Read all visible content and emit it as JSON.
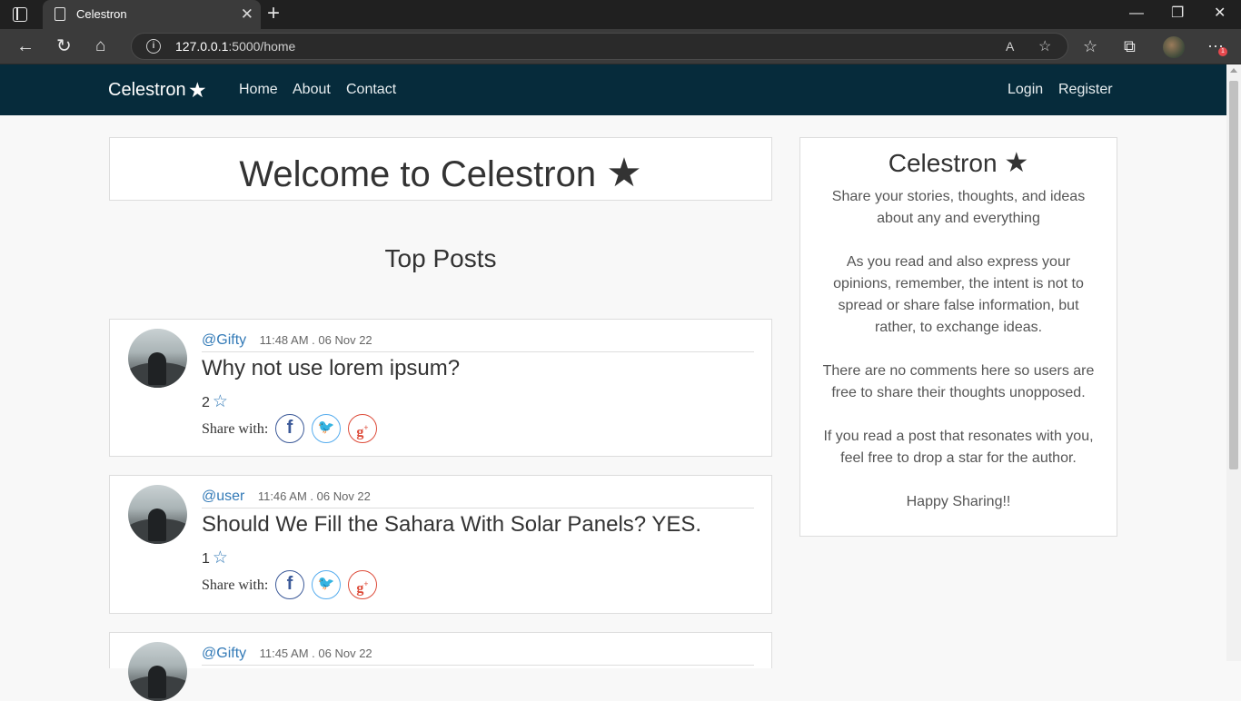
{
  "browser": {
    "tab_title": "Celestron",
    "tab_close": "✕",
    "new_tab": "+",
    "url_host": "127.0.0.1",
    "url_path": ":5000/home",
    "window_controls": {
      "minimize": "—",
      "maximize": "❐",
      "close": "✕"
    }
  },
  "site": {
    "brand": "Celestron",
    "nav": {
      "home": "Home",
      "about": "About",
      "contact": "Contact",
      "login": "Login",
      "register": "Register"
    },
    "colors": {
      "navbar": "#062b3b",
      "link": "#337ab7"
    }
  },
  "main": {
    "welcome": "Welcome to Celestron",
    "top_posts_heading": "Top Posts",
    "share_label": "Share with:",
    "posts": [
      {
        "user": "@Gifty",
        "time": "11:48 AM . 06 Nov 22",
        "title": "Why not use lorem ipsum?",
        "stars": "2"
      },
      {
        "user": "@user",
        "time": "11:46 AM . 06 Nov 22",
        "title": "Should We Fill the Sahara With Solar Panels? YES.",
        "stars": "1"
      },
      {
        "user": "@Gifty",
        "time": "11:45 AM . 06 Nov 22",
        "title": "",
        "stars": ""
      }
    ]
  },
  "sidebar": {
    "title": "Celestron",
    "paragraphs": [
      "Share your stories, thoughts, and ideas about any and everything",
      "As you read and also express your opinions, remember, the intent is not to spread or share false information, but rather, to exchange ideas.",
      "There are no comments here so users are free to share their thoughts unopposed.",
      "If you read a post that resonates with you, feel free to drop a star for the author.",
      "Happy Sharing!!"
    ]
  },
  "icons": [
    "tab-actions-icon",
    "page-icon",
    "back-icon",
    "refresh-icon",
    "home-icon",
    "info-icon",
    "read-aloud-icon",
    "add-favorite-icon",
    "favorites-icon",
    "collections-icon",
    "profile-icon",
    "more-icon",
    "star-icon",
    "facebook-icon",
    "twitter-icon",
    "google-plus-icon"
  ]
}
